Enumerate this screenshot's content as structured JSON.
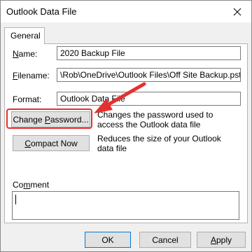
{
  "window": {
    "title": "Outlook Data File"
  },
  "tabs": [
    {
      "label": "General",
      "active": true
    }
  ],
  "fields": {
    "name": {
      "label": "Name:",
      "value": "2020 Backup File"
    },
    "filename": {
      "label": "Filename:",
      "value": "\\Rob\\OneDrive\\Outlook Files\\Off Site Backup.pst"
    },
    "format": {
      "label": "Format:",
      "value": "Outlook Data File"
    }
  },
  "actions": {
    "change_password": {
      "label": "Change Password...",
      "description": [
        "Changes the password used to",
        "access the Outlook data file"
      ]
    },
    "compact_now": {
      "label": "Compact Now",
      "description": [
        "Reduces the size of your Outlook",
        "data file"
      ]
    }
  },
  "comment": {
    "label": "Comment",
    "value": ""
  },
  "footer": {
    "ok_label": "OK",
    "cancel_label": "Cancel",
    "apply_label": "Apply"
  },
  "colors": {
    "annotation_red": "#e53030",
    "dialog_bg": "#f0f0f0",
    "panel_bg": "#ffffff"
  },
  "icons": {
    "close": "close-icon",
    "annotation_arrow": "arrow-icon"
  }
}
